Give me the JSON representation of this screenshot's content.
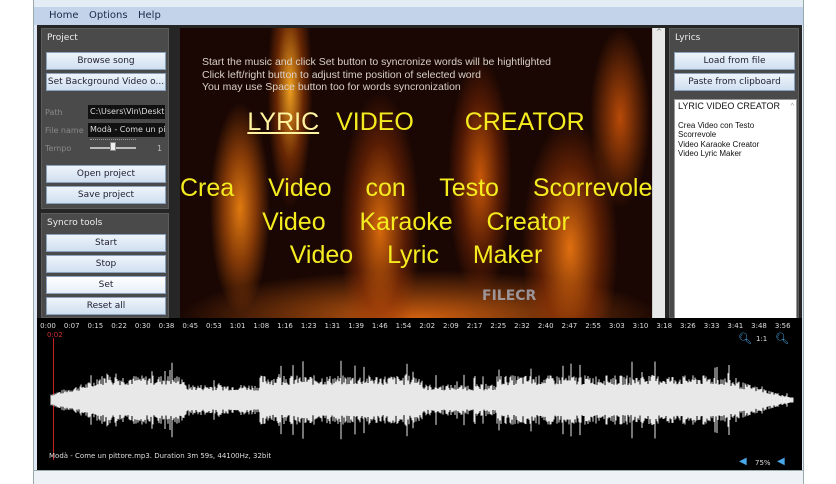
{
  "menu": {
    "items": [
      "Home",
      "Options",
      "Help"
    ]
  },
  "project": {
    "title": "Project",
    "browse_song": "Browse song",
    "set_background": "Set Background Video o...",
    "path_label": "Path",
    "path_value": "C:\\Users\\Vin\\Deskt",
    "file_label": "File name",
    "file_value": "Modà - Come un pitt",
    "tempo_label": "Tempo",
    "tempo_value": "1",
    "tempo_position": 0.5,
    "open_project": "Open project",
    "save_project": "Save project"
  },
  "syncro": {
    "title": "Syncro tools",
    "start": "Start",
    "stop": "Stop",
    "set": "Set",
    "reset": "Reset all"
  },
  "video": {
    "hint_lines": [
      "Start the music and click Set button to syncronize words will be hightlighted",
      "Click left/right button to adjust time position of selected word",
      "You may use Space button too for words syncronization"
    ],
    "title_highlight": "LYRIC",
    "title_rest": "VIDEO   CREATOR",
    "lines": [
      "Crea  Video  con  Testo  Scorrevole",
      "Video  Karaoke  Creator",
      "Video  Lyric  Maker"
    ],
    "watermark": "FILECR"
  },
  "lyrics": {
    "title": "Lyrics",
    "load_file": "Load from file",
    "paste": "Paste from clipboard",
    "text_lines": [
      "LYRIC VIDEO CREATOR",
      "",
      "Crea Video con Testo",
      "Scorrevole",
      "Video Karaoke Creator",
      "Video Lyric Maker"
    ]
  },
  "timeline": {
    "ticks": [
      "0:00",
      "0:07",
      "0:15",
      "0:22",
      "0:30",
      "0:38",
      "0:45",
      "0:53",
      "1:01",
      "1:08",
      "1:16",
      "1:23",
      "1:31",
      "1:39",
      "1:46",
      "1:54",
      "2:02",
      "2:09",
      "2:17",
      "2:25",
      "2:32",
      "2:40",
      "2:47",
      "2:55",
      "3:03",
      "3:10",
      "3:18",
      "3:26",
      "3:33",
      "3:41",
      "3:48",
      "3:56"
    ],
    "cursor_time": "0:02",
    "zoom_label": "1:1",
    "file_info": "Modà - Come un pittore.mp3.  Duration 3m 59s, 44100Hz, 32bit",
    "volume": "75%",
    "cursor_color": "#d02020"
  }
}
